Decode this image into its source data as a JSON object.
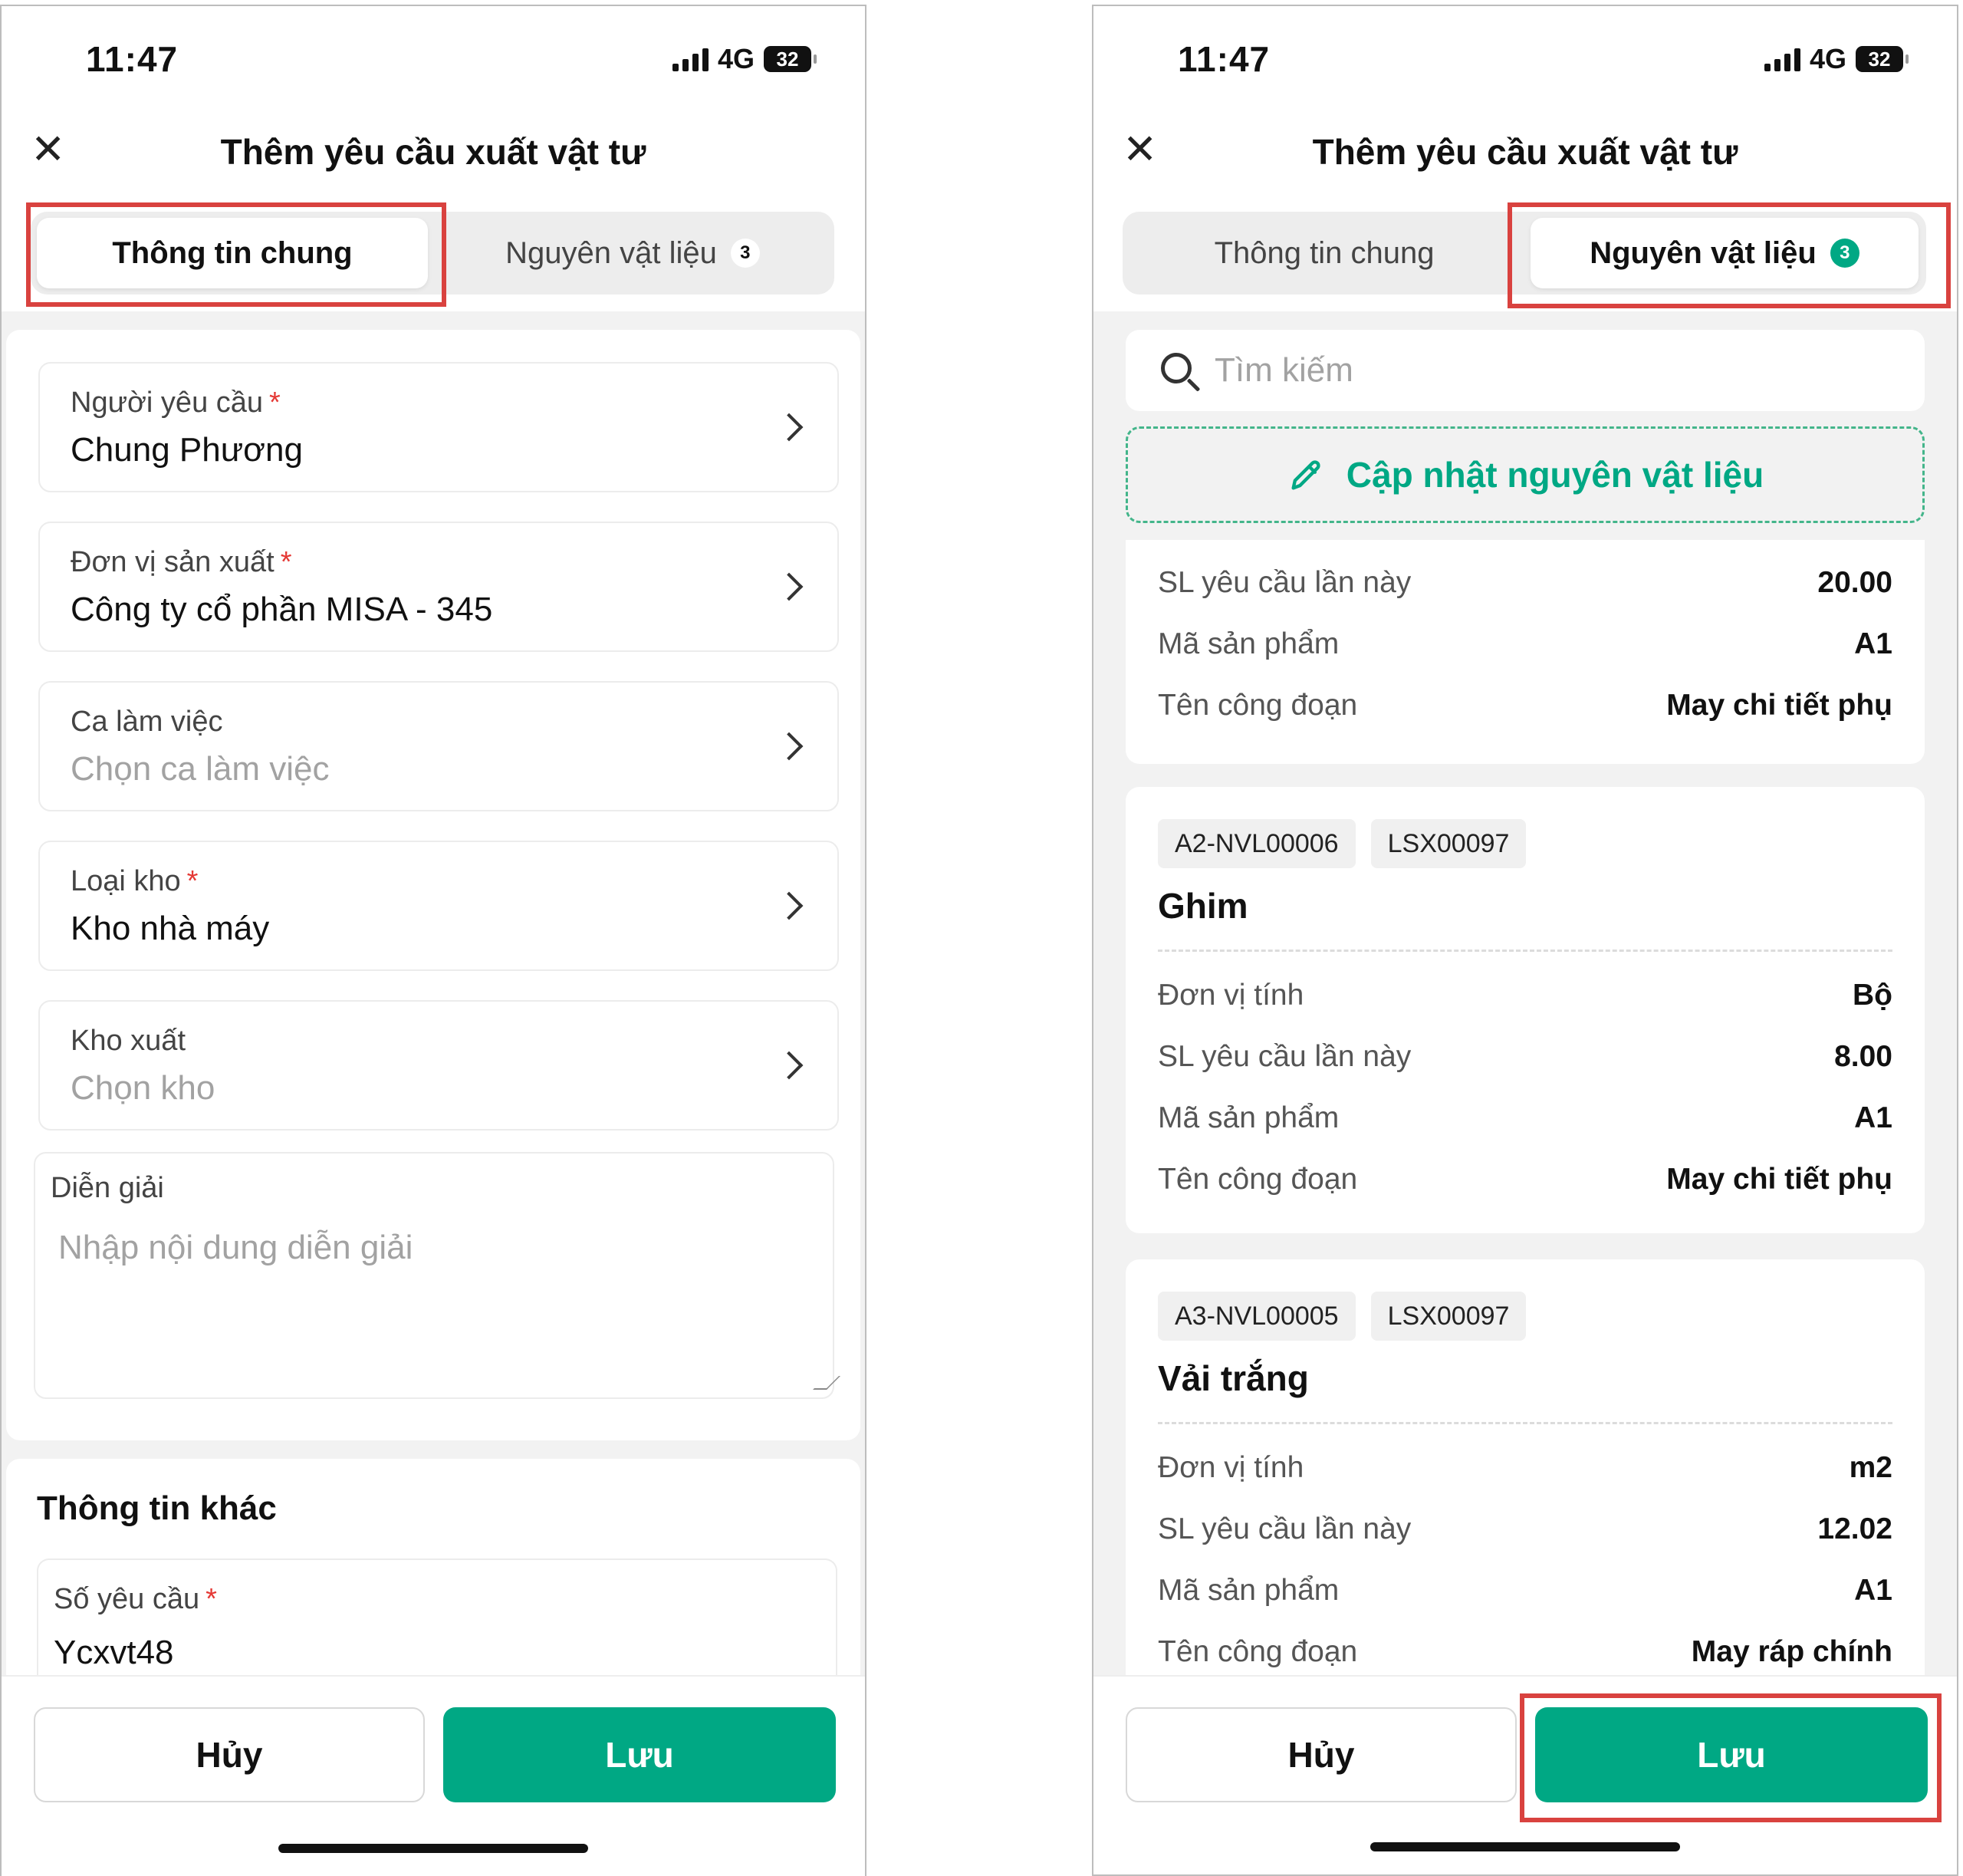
{
  "status_bar": {
    "time": "11:47",
    "network": "4G",
    "battery": "32"
  },
  "header": {
    "title": "Thêm yêu cầu xuất vật tư"
  },
  "tabs": {
    "general": "Thông tin chung",
    "materials": "Nguyên vật liệu",
    "materials_count": "3"
  },
  "form": {
    "fields": [
      {
        "label": "Người yêu cầu",
        "value": "Chung Phương"
      },
      {
        "label": "Đơn vị sản xuất",
        "value": "Công ty cổ phần MISA - 345"
      },
      {
        "label": "Ca làm việc",
        "placeholder": "Chọn ca làm việc"
      },
      {
        "label": "Loại kho",
        "value": "Kho nhà máy"
      },
      {
        "label": "Kho xuất",
        "placeholder": "Chọn kho"
      }
    ],
    "description": {
      "label": "Diễn giải",
      "placeholder": "Nhập nội dung diễn giải"
    }
  },
  "other": {
    "title": "Thông tin khác",
    "field": {
      "label": "Số yêu cầu",
      "value": "Ycxvt48"
    }
  },
  "buttons": {
    "cancel": "Hủy",
    "save": "Lưu"
  },
  "materials": {
    "search_placeholder": "Tìm kiếm",
    "update_label": "Cập nhật nguyên vật liệu",
    "first_card_rows": [
      {
        "label": "SL yêu cầu lần này",
        "value": "20.00"
      },
      {
        "label": "Mã sản phẩm",
        "value": "A1"
      },
      {
        "label": "Tên công đoạn",
        "value": "May chi tiết phụ"
      }
    ],
    "cards": [
      {
        "tags": [
          "A2-NVL00006",
          "LSX00097"
        ],
        "name": "Ghim",
        "rows": [
          {
            "label": "Đơn vị tính",
            "value": "Bộ"
          },
          {
            "label": "SL yêu cầu lần này",
            "value": "8.00"
          },
          {
            "label": "Mã sản phẩm",
            "value": "A1"
          },
          {
            "label": "Tên công đoạn",
            "value": "May chi tiết phụ"
          }
        ]
      },
      {
        "tags": [
          "A3-NVL00005",
          "LSX00097"
        ],
        "name": "Vải trắng",
        "rows": [
          {
            "label": "Đơn vị tính",
            "value": "m2"
          },
          {
            "label": "SL yêu cầu lần này",
            "value": "12.02"
          },
          {
            "label": "Mã sản phẩm",
            "value": "A1"
          },
          {
            "label": "Tên công đoạn",
            "value": "May ráp chính"
          }
        ]
      }
    ]
  },
  "colors": {
    "accent": "#00a884",
    "highlight": "#d9423f",
    "required": "#e53935"
  }
}
